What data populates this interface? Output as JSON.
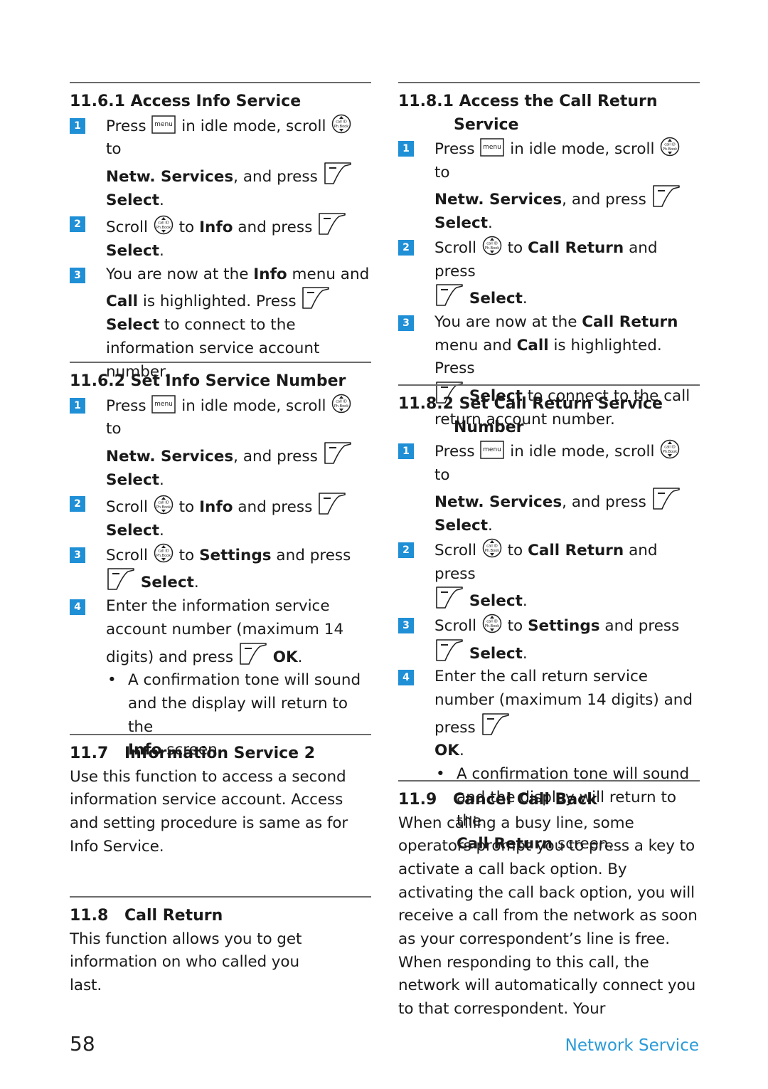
{
  "left": {
    "s1161": {
      "heading": "11.6.1 Access Info Service",
      "steps": [
        {
          "n": "1",
          "parts": [
            "Press",
            "in idle mode, scroll",
            "to",
            "Netw. Services",
            ", and press",
            "Select",
            "."
          ]
        },
        {
          "n": "2",
          "parts": [
            "Scroll",
            "to",
            "Info",
            "and press",
            "Select",
            "."
          ]
        },
        {
          "n": "3",
          "parts": [
            "You are now at the",
            "Info",
            "menu and",
            "Call",
            "is highlighted. Press",
            "Select",
            "to connect to the information service account number."
          ]
        }
      ]
    },
    "s1162": {
      "heading": "11.6.2 Set Info Service Number",
      "steps": [
        {
          "n": "1",
          "parts": [
            "Press",
            "in idle mode, scroll",
            "to",
            "Netw. Services",
            ", and press",
            "Select",
            "."
          ]
        },
        {
          "n": "2",
          "parts": [
            "Scroll",
            "to",
            "Info",
            "and press",
            "Select",
            "."
          ]
        },
        {
          "n": "3",
          "parts": [
            "Scroll",
            "to",
            "Settings",
            "and press",
            "Select",
            "."
          ]
        },
        {
          "n": "4",
          "parts": [
            "Enter the information service account number (maximum 14 digits) and press",
            "OK",
            "."
          ]
        }
      ],
      "bullet": {
        "parts": [
          "A confirmation tone will sound and the display will return to the",
          "Info",
          "screen."
        ]
      }
    },
    "s117": {
      "number": "11.7",
      "title": "Information Service 2",
      "body": "Use this function to access a second information service account. Access and setting procedure is same as for Info Service."
    },
    "s118": {
      "number": "11.8",
      "title": "Call Return",
      "body": "This function allows you to get information on who called you last."
    }
  },
  "right": {
    "s1181": {
      "heading1": "11.8.1 Access the Call Return",
      "heading2": "Service",
      "steps": [
        {
          "n": "1",
          "parts": [
            "Press",
            "in idle mode, scroll",
            "to",
            "Netw. Services",
            ", and press",
            "Select",
            "."
          ]
        },
        {
          "n": "2",
          "parts": [
            "Scroll",
            "to",
            "Call Return",
            "and press",
            "Select",
            "."
          ]
        },
        {
          "n": "3",
          "parts": [
            "You are now at the",
            "Call Return",
            "menu and",
            "Call",
            "is highlighted. Press",
            "Select",
            "to connect to the call return account number."
          ]
        }
      ]
    },
    "s1182": {
      "heading1": "11.8.2 Set Call Return Service",
      "heading2": "Number",
      "steps": [
        {
          "n": "1",
          "parts": [
            "Press",
            "in idle mode, scroll",
            "to",
            "Netw. Services",
            ", and press",
            "Select",
            "."
          ]
        },
        {
          "n": "2",
          "parts": [
            "Scroll",
            "to",
            "Call Return",
            "and press",
            "Select",
            "."
          ]
        },
        {
          "n": "3",
          "parts": [
            "Scroll",
            "to",
            "Settings",
            "and press",
            "Select",
            "."
          ]
        },
        {
          "n": "4",
          "parts": [
            "Enter the call return service number (maximum 14 digits) and press",
            "OK",
            "."
          ]
        }
      ],
      "bullet": {
        "parts": [
          "A confirmation tone will sound and the display will return to the",
          "Call Return",
          "screen."
        ]
      }
    },
    "s119": {
      "number": "11.9",
      "title": "Cancel Call Back",
      "body": "When calling a busy line, some operators prompt you to press a key to activate a call back option. By activating the call back option, you will receive a call from the network as soon as your correspondent’s line is free. When responding to this call, the network will automatically connect you to that correspondent. Your"
    }
  },
  "icons": {
    "menu_key_label": "menu",
    "nav_top": "call ID",
    "nav_bottom": "Ph.Book",
    "bullet": "•"
  },
  "footer": {
    "page_number": "58",
    "chapter_title": "Network Service"
  },
  "colors": {
    "badge": "#1f8fd6",
    "footer_title": "#2a9ad8",
    "rule": "#6b6b6b"
  }
}
